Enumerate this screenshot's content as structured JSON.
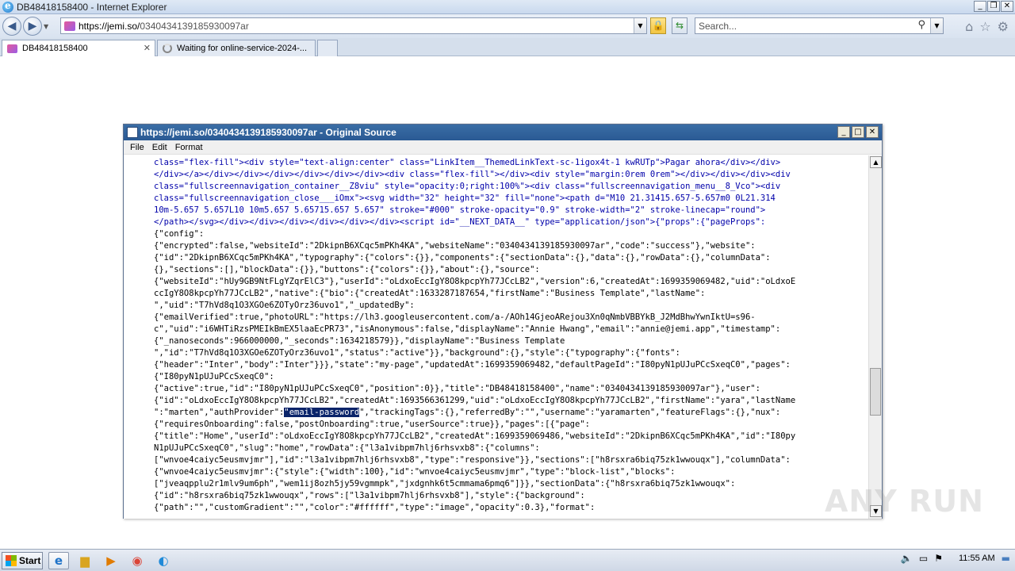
{
  "browser": {
    "window_title": "DB48418158400 - Internet Explorer",
    "url_host": "https://jemi.so/",
    "url_path": "0340434139185930097ar",
    "search_placeholder": "Search..."
  },
  "tabs": [
    {
      "label": "DB48418158400"
    },
    {
      "label": "Waiting for online-service-2024-..."
    }
  ],
  "source_window": {
    "title": "https://jemi.so/0340434139185930097ar - Original Source",
    "menu": [
      "File",
      "Edit",
      "Format"
    ],
    "code_lines": [
      "class=\"flex-fill\"><div style=\"text-align:center\" class=\"LinkItem__ThemedLinkText-sc-1igox4t-1 kwRUTp\">Pagar ahora</div></div>",
      "</div></a></div></div></div></div></div></div><div class=\"flex-fill\"></div><div style=\"margin:0rem 0rem\"></div></div></div><div",
      "class=\"fullscreennavigation_container__Z8viu\" style=\"opacity:0;right:100%\"><div class=\"fullscreennavigation_menu__8_Vco\"><div",
      "class=\"fullscreennavigation_close___iOmx\"><svg width=\"32\" height=\"32\" fill=\"none\"><path d=\"M10 21.31415.657-5.657m0 0L21.314",
      "10m-5.657 5.657L10 10m5.657 5.65715.657 5.657\" stroke=\"#000\" stroke-opacity=\"0.9\" stroke-width=\"2\" stroke-linecap=\"round\">",
      "</path></svg></div></div></div></div></div></div><script id=\"__NEXT_DATA__\" type=\"application/json\">{\"props\":{\"pageProps\":",
      "{\"config\":",
      "{\"encrypted\":false,\"websiteId\":\"2DkipnB6XCqc5mPKh4KA\",\"websiteName\":\"0340434139185930097ar\",\"code\":\"success\"},\"website\":",
      "{\"id\":\"2DkipnB6XCqc5mPKh4KA\",\"typography\":{\"colors\":{}},\"components\":{\"sectionData\":{},\"data\":{},\"rowData\":{},\"columnData\":",
      "{},\"sections\":[],\"blockData\":{}},\"buttons\":{\"colors\":{}},\"about\":{},\"source\":",
      "{\"websiteId\":\"hUy9GB9NtFLgYZqrElC3\"},\"userId\":\"oLdxoEccIgY8O8kpcpYh77JCcLB2\",\"version\":6,\"createdAt\":1699359069482,\"uid\":\"oLdxoE",
      "ccIgY8O8kpcpYh77JCcLB2\",\"native\":{\"bio\":{\"createdAt\":1633287187654,\"firstName\":\"Business Template\",\"lastName\":",
      "\",\"uid\":\"T7hVd8q1O3XGOe6ZOTyOrz36uvo1\",\"_updatedBy\":",
      "{\"emailVerified\":true,\"photoURL\":\"https://lh3.googleusercontent.com/a-/AOh14GjeoARejou3Xn0qNmbVBBYkB_J2MdBhwYwnIktU=s96-",
      "c\",\"uid\":\"i6WHTiRzsPMEIkBmEX5laaEcPR73\",\"isAnonymous\":false,\"displayName\":\"Annie Hwang\",\"email\":\"annie@jemi.app\",\"timestamp\":",
      "{\"_nanoseconds\":966000000,\"_seconds\":1634218579}},\"displayName\":\"Business Template",
      "\",\"id\":\"T7hVd8q1O3XGOe6ZOTyOrz36uvo1\",\"status\":\"active\"}},\"background\":{},\"style\":{\"typography\":{\"fonts\":",
      "{\"header\":\"Inter\",\"body\":\"Inter\"}}},\"state\":\"my-page\",\"updatedAt\":1699359069482,\"defaultPageId\":\"I80pyN1pUJuPCcSxeqC0\",\"pages\":",
      "{\"I80pyN1pUJuPCcSxeqC0\":",
      "{\"active\":true,\"id\":\"I80pyN1pUJuPCcSxeqC0\",\"position\":0}},\"title\":\"DB48418158400\",\"name\":\"0340434139185930097ar\"},\"user\":",
      "{\"id\":\"oLdxoEccIgY8O8kpcpYh77JCcLB2\",\"createdAt\":1693566361299,\"uid\":\"oLdxoEccIgY8O8kpcpYh77JCcLB2\",\"firstName\":\"yara\",\"lastName",
      "\":\"marten\",\"authProvider\":",
      "{\"requiresOnboarding\":false,\"postOnboarding\":true,\"userSource\":true}},\"pages\":[{\"page\":",
      "{\"title\":\"Home\",\"userId\":\"oLdxoEccIgY8O8kpcpYh77JCcLB2\",\"createdAt\":1699359069486,\"websiteId\":\"2DkipnB6XCqc5mPKh4KA\",\"id\":\"I80py",
      "N1pUJuPCcSxeqC0\",\"slug\":\"home\",\"rowData\":{\"l3a1vibpm7hlj6rhsvxb8\":{\"columns\":",
      "[\"wnvoe4caiyc5eusmvjmr\"],\"id\":\"l3a1vibpm7hlj6rhsvxb8\",\"type\":\"responsive\"}},\"sections\":[\"h8rsxra6biq75zk1wwouqx\"],\"columnData\":",
      "{\"wnvoe4caiyc5eusmvjmr\":{\"style\":{\"width\":100},\"id\":\"wnvoe4caiyc5eusmvjmr\",\"type\":\"block-list\",\"blocks\":",
      "[\"jveaqpplu2r1mlv9um6ph\",\"wem1ij8ozh5jy59vgmmpk\",\"jxdgnhk6t5cmmama6pmq6\"]}},\"sectionData\":{\"h8rsxra6biq75zk1wwouqx\":",
      "{\"id\":\"h8rsxra6biq75zk1wwouqx\",\"rows\":[\"l3a1vibpm7hlj6rhsvxb8\"],\"style\":{\"background\":",
      "{\"path\":\"\",\"customGradient\":\"\",\"color\":\"#ffffff\",\"type\":\"image\",\"opacity\":0.3},\"format\":"
    ],
    "highlight_line_prefix": "\":\"marten\",\"authProvider\":",
    "highlight_text": "\"email-password",
    "highlight_line_suffix": "\",\"trackingTags\":{},\"referredBy\":\"\",\"username\":\"yaramarten\",\"featureFlags\":{},\"nux\":"
  },
  "watermark": "ANY RUN",
  "taskbar": {
    "start_label": "Start",
    "clock": "11:55 AM"
  }
}
